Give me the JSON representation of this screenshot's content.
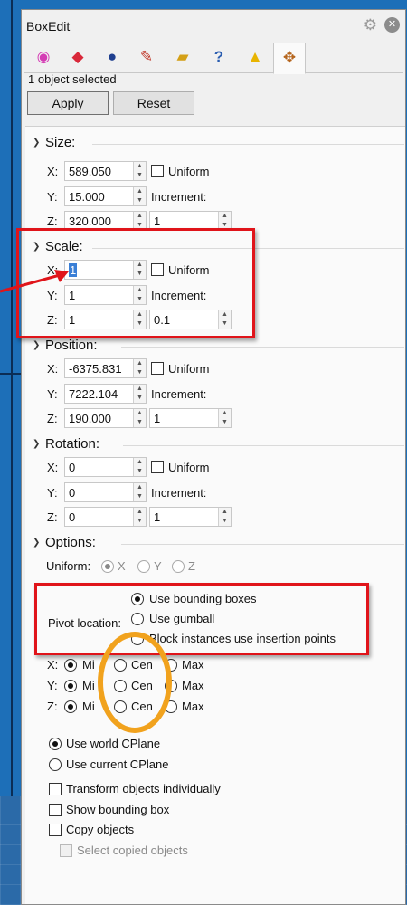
{
  "window": {
    "title": "BoxEdit"
  },
  "tabs": [
    {
      "name": "properties",
      "glyph": "◉",
      "color": "#d43cb4"
    },
    {
      "name": "material",
      "glyph": "◆",
      "color": "#d9283a"
    },
    {
      "name": "environment",
      "glyph": "●",
      "color": "#1f3f8f"
    },
    {
      "name": "layers",
      "glyph": "✎",
      "color": "#c0392b"
    },
    {
      "name": "files",
      "glyph": "▰",
      "color": "#d4a017"
    },
    {
      "name": "help",
      "glyph": "?",
      "color": "#2a5db0"
    },
    {
      "name": "notifications",
      "glyph": "▲",
      "color": "#e8b400"
    },
    {
      "name": "boxedit",
      "glyph": "✥",
      "color": "#b5651d"
    }
  ],
  "status_text": "1 object selected",
  "buttons": {
    "apply": "Apply",
    "reset": "Reset"
  },
  "common": {
    "uniform": "Uniform",
    "increment": "Increment:",
    "x": "X:",
    "y": "Y:",
    "z": "Z:"
  },
  "size": {
    "title": "Size:",
    "x": "589.050",
    "y": "15.000",
    "z": "320.000",
    "increment": "1"
  },
  "scale": {
    "title": "Scale:",
    "x": "1",
    "y": "1",
    "z": "1",
    "increment": "0.1"
  },
  "position": {
    "title": "Position:",
    "x": "-6375.831",
    "y": "7222.104",
    "z": "190.000",
    "increment": "1"
  },
  "rotation": {
    "title": "Rotation:",
    "x": "0",
    "y": "0",
    "z": "0",
    "increment": "1"
  },
  "options": {
    "title": "Options:",
    "uniform_label": "Uniform:",
    "uniform_axes": [
      "X",
      "Y",
      "Z"
    ],
    "pivot_label": "Pivot location:",
    "pivot_options": [
      "Use bounding boxes",
      "Use gumball",
      "Block instances use insertion points"
    ],
    "axis_rows": [
      {
        "axis": "X:",
        "min": "Mi",
        "cen": "Cen",
        "max": "Max"
      },
      {
        "axis": "Y:",
        "min": "Mi",
        "cen": "Cen",
        "max": "Max"
      },
      {
        "axis": "Z:",
        "min": "Mi",
        "cen": "Cen",
        "max": "Max"
      }
    ],
    "cplane_options": [
      "Use world CPlane",
      "Use current CPlane"
    ],
    "checkboxes": [
      "Transform objects individually",
      "Show bounding box",
      "Copy objects"
    ],
    "select_copied": "Select copied objects"
  },
  "colors": {
    "annotation_red": "#e0141a",
    "annotation_orange": "#f1a21d",
    "viewport_blue": "#1d6fb8"
  }
}
